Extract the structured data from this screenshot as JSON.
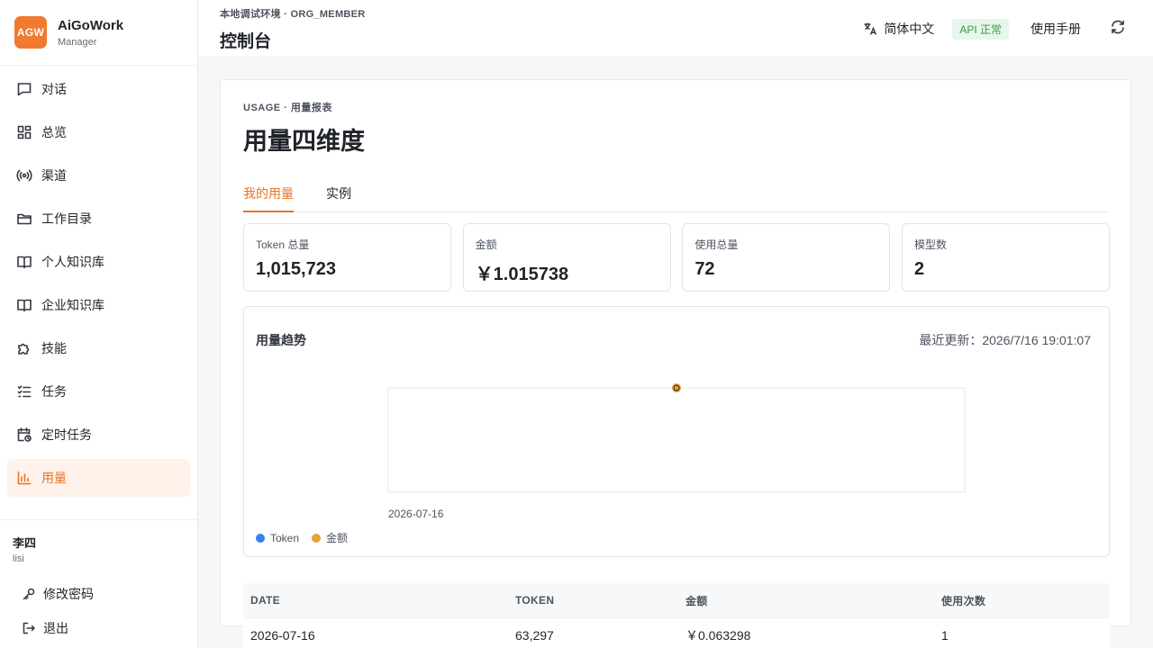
{
  "brand": {
    "logo": "AGW",
    "name": "AiGoWork",
    "sub": "Manager"
  },
  "nav": [
    {
      "label": "对话",
      "icon": "chat-icon"
    },
    {
      "label": "总览",
      "icon": "dashboard-icon"
    },
    {
      "label": "渠道",
      "icon": "broadcast-icon"
    },
    {
      "label": "工作目录",
      "icon": "folder-icon"
    },
    {
      "label": "个人知识库",
      "icon": "book-icon"
    },
    {
      "label": "企业知识库",
      "icon": "book-icon"
    },
    {
      "label": "技能",
      "icon": "puzzle-icon"
    },
    {
      "label": "任务",
      "icon": "checklist-icon"
    },
    {
      "label": "定时任务",
      "icon": "calendar-clock-icon"
    },
    {
      "label": "用量",
      "icon": "bar-chart-icon",
      "active": true
    }
  ],
  "user": {
    "name": "李四",
    "id": "lisi",
    "change_password": "修改密码",
    "logout": "退出"
  },
  "header": {
    "env": "本地调试环境 · ORG_MEMBER",
    "title": "控制台",
    "language": "简体中文",
    "api_status": "API 正常",
    "manual": "使用手册"
  },
  "main": {
    "kicker": "USAGE · 用量报表",
    "title": "用量四维度",
    "tabs": [
      {
        "label": "我的用量",
        "active": true
      },
      {
        "label": "实例",
        "active": false
      }
    ],
    "stats": [
      {
        "label": "Token 总量",
        "value": "1,015,723"
      },
      {
        "label": "金额",
        "value": "￥1.015738"
      },
      {
        "label": "使用总量",
        "value": "72"
      },
      {
        "label": "模型数",
        "value": "2"
      }
    ]
  },
  "chart": {
    "title": "用量趋势",
    "updated_label": "最近更新：",
    "updated_value": "2026/7/16 19:01:07",
    "colors": {
      "token": "#3b7ff0",
      "amount": "#e8a23a"
    }
  },
  "chart_data": {
    "type": "line",
    "categories": [
      "2026-07-16"
    ],
    "series": [
      {
        "name": "Token",
        "values": [
          63297
        ]
      },
      {
        "name": "金额",
        "values": [
          0.063298
        ]
      }
    ],
    "xlabel": "",
    "ylabel": "",
    "grid": false,
    "legend": "bottom-left"
  },
  "table": {
    "headers": [
      "DATE",
      "TOKEN",
      "金额",
      "使用次数"
    ],
    "rows": [
      [
        "2026-07-16",
        "63,297",
        "￥0.063298",
        "1"
      ]
    ]
  }
}
